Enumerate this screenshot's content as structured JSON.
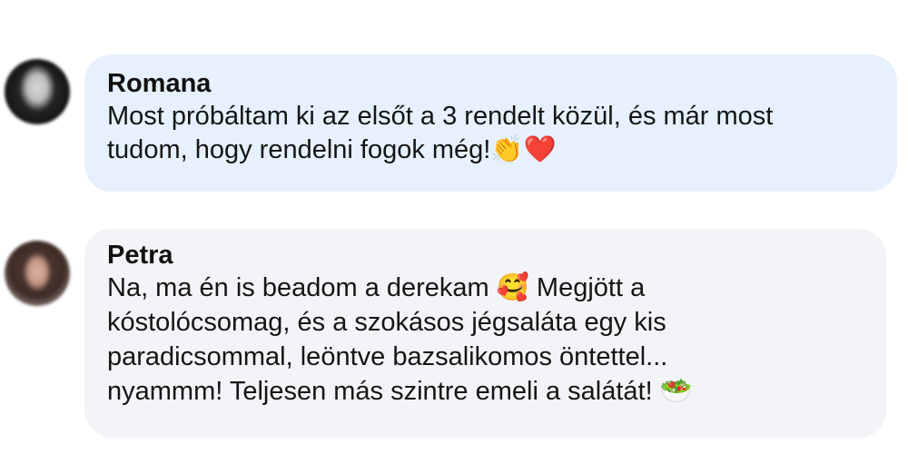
{
  "comments": [
    {
      "author": "Romana",
      "text": "Most próbáltam ki az elsőt a 3 rendelt közül, és már most\ntudom, hogy rendelni fogok még!👏❤️",
      "colors": {
        "bubble": "#e6f1fd"
      }
    },
    {
      "author": "Petra",
      "text": "Na, ma én is beadom a derekam 🥰 Megjött a\nkóstolócsomag, és a szokásos jégsaláta egy kis\nparadicsommal, leöntve bazsalikomos öntettel...\nnyammm! Teljesen más szintre emeli a salátát! 🥗",
      "colors": {
        "bubble": "#f3f4f7"
      }
    }
  ]
}
